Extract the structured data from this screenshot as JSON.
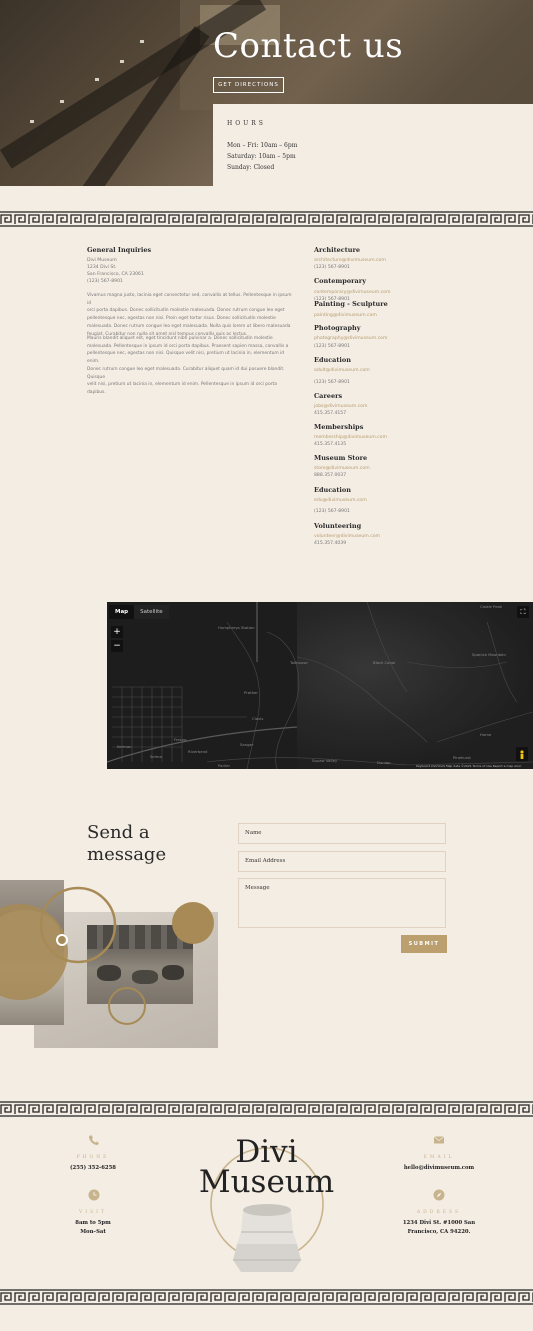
{
  "hero": {
    "title": "Contact us",
    "directions_button": "GET DIRECTIONS"
  },
  "hours": {
    "title": "HOURS",
    "lines": [
      "Mon – Fri: 10am – 6pm",
      "Saturday: 10am – 5pm",
      "Sunday: Closed"
    ]
  },
  "general": {
    "heading": "General Inquiries",
    "address": [
      "Divi Museum",
      "1234 Divi St.",
      "San Francisco, CA 23061",
      "(123) 567-8901"
    ],
    "paragraphs": [
      [
        "Vivamus magna justo, lacinia eget consectetur sed, convallis at tellus. Pellentesque in ipsum id",
        "orci porta dapibus. Donec sollicitudin molestie malesuada. Donec rutrum congue leo eget",
        "pellentesque nec, egestas non nisi. Proin eget tortor risus. Donec sollicitudin molestie",
        "malesuada. Donec rutrum congue leo eget malesuada. Nulla quis lorem ut libero malesuada",
        "feugiat. Curabitur non nulla sit amet nisl tempus convallis quis ac lectus."
      ],
      [
        "Mauris blandit aliquet elit, eget tincidunt nibh pulvinar a. Donec sollicitudin molestie",
        "malesuada. Pellentesque in ipsum id orci porta dapibus. Praesent sapien massa, convallis a",
        "pellentesque nec, egestas non nisi. Quisque velit nisi, pretium ut lacinia in, elementum id enim.",
        "Donec rutrum congue leo eget malesuada. Curabitur aliquet quam id dui posuere blandit. Quisque",
        "velit nisi, pretium ut lacinia in, elementum id enim. Pellentesque in ipsum id orci porta dapibus."
      ]
    ]
  },
  "departments": [
    {
      "name": "Architecture",
      "email": "architecture@divimuseum.com",
      "phone": "(123) 567-8901"
    },
    {
      "name": "Contemporary",
      "email": "contemporary@divimuseum.com",
      "phone": "(123) 567-8901"
    },
    {
      "name": "Painting - Sculpture",
      "email": "painting@divimuseum.com",
      "phone": ""
    },
    {
      "name": "Photography",
      "email": "photography@divimuseum.com",
      "phone": "(123) 567-8901"
    },
    {
      "name": "Education",
      "email": "adult@divimuseum.com",
      "phone": "(123) 567-8901"
    },
    {
      "name": "Careers",
      "email": "jobs@divimuseum.com",
      "phone": "415.357.4157"
    },
    {
      "name": "Memberships",
      "email": "membership@divimuseum.com",
      "phone": "415.357.4135"
    },
    {
      "name": "Museum Store",
      "email": "store@divimuseum.com",
      "phone": "888.357.0037"
    },
    {
      "name": "Education",
      "email": "edu@divimuseum.com",
      "phone": "(123) 567-8901"
    },
    {
      "name": "Volunteering",
      "email": "volunteer@divimuseum.com",
      "phone": "415.357.4039"
    }
  ],
  "map": {
    "tab_map": "Map",
    "tab_satellite": "Satellite",
    "zoom_in": "+",
    "zoom_out": "−",
    "labels": [
      "Castle Peak",
      "Humphreys Station",
      "Tollhouse",
      "Black Canal",
      "Spanish Mountain",
      "Prather",
      "Clovis",
      "Fresno",
      "Sanger",
      "Parlier",
      "Squaw Valley",
      "Dunlap",
      "Kerman",
      "Selma",
      "Riverbend",
      "Pinehurst",
      "Hume"
    ],
    "footer": "Keyboard shortcuts   Map data ©2021   Terms of Use   Report a map error"
  },
  "form": {
    "title_line1": "Send a",
    "title_line2": "message",
    "name_placeholder": "Name",
    "email_placeholder": "Email Address",
    "message_placeholder": "Message",
    "submit": "SUBMIT"
  },
  "footer": {
    "logo_line1": "Divi",
    "logo_line2": "Museum",
    "phone_label": "PHONE",
    "phone_value": "(255) 352-6258",
    "visit_label": "VISIT",
    "visit_line1": "8am to 5pm",
    "visit_line2": "Mon–Sat",
    "email_label": "EMAIL",
    "email_value": "hello@divimuseum.com",
    "address_label": "ADDRESS",
    "address_line1": "1234 Divi St. #1000 San",
    "address_line2": "Francisco, CA 94220."
  },
  "colors": {
    "background": "#f4ede4",
    "accent": "#bb9f6f",
    "link": "#b59c6c"
  }
}
